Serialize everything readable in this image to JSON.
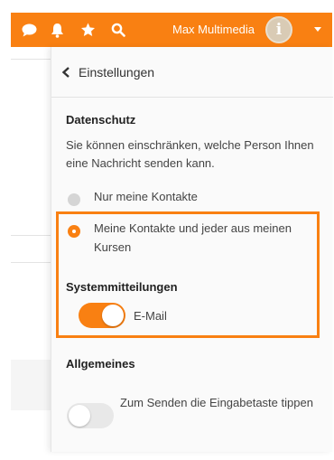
{
  "topbar": {
    "background": "#f98012",
    "icons": [
      "chat-icon",
      "bell-icon",
      "star-icon",
      "search-icon"
    ],
    "user_name": "Max Multimedia",
    "avatar_letter": "i"
  },
  "drawer": {
    "back_label": "Einstellungen",
    "privacy": {
      "title": "Datenschutz",
      "description": "Sie können einschränken, welche Person Ihnen eine Nachricht senden kann.",
      "options": [
        {
          "label": "Nur meine Kontakte",
          "selected": false
        },
        {
          "label": "Meine Kontakte und jeder aus meinen Kursen",
          "selected": true
        }
      ]
    },
    "system": {
      "title": "Systemmitteilungen",
      "email_label": "E-Mail",
      "email_enabled": true
    },
    "general": {
      "title": "Allgemeines",
      "enter_send_label": "Zum Senden die Eingabetaste tippen",
      "enter_send_enabled": false
    }
  },
  "colors": {
    "accent": "#f98012",
    "inactive_radio": "#d5d5d5",
    "toggle_off": "#e8e8e8"
  }
}
